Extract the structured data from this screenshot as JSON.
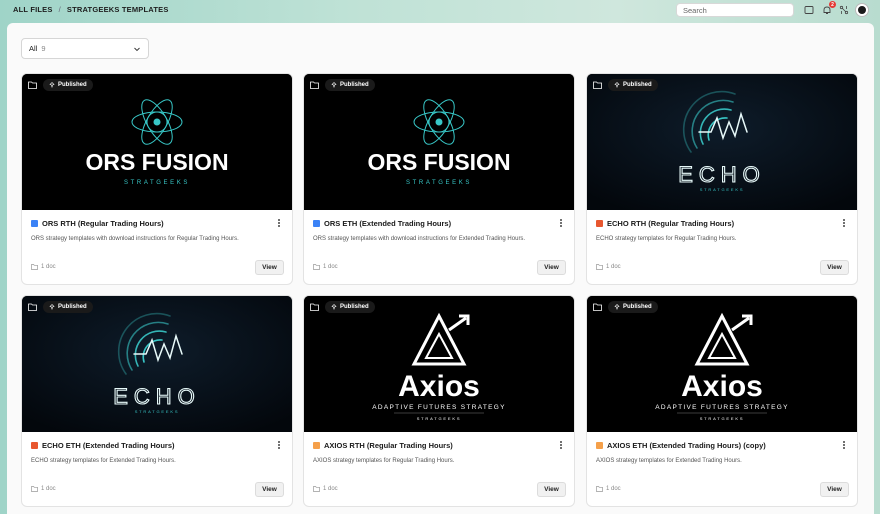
{
  "breadcrumb": {
    "root": "ALL FILES",
    "separator": "/",
    "current": "STRATGEEKS TEMPLATES"
  },
  "search": {
    "placeholder": "Search"
  },
  "toolbar": {
    "icons": [
      "chat-icon",
      "bell-icon",
      "network-icon"
    ],
    "notification_count": "2"
  },
  "filter": {
    "label": "All",
    "count": "9"
  },
  "published_label": "Published",
  "view_label": "View",
  "colors": {
    "blue": "#3b82f6",
    "red": "#e8572f",
    "orange": "#f5a04a",
    "teal": "#38c7c7"
  },
  "cards": [
    {
      "art": "ors",
      "art_title": "ORS FUSION",
      "art_sub": "STRATGEEKS",
      "square_color": "#3b82f6",
      "title": "ORS RTH (Regular Trading Hours)",
      "desc": "ORS strategy templates with download instructions for Regular Trading Hours.",
      "meta": "1 doc"
    },
    {
      "art": "ors",
      "art_title": "ORS FUSION",
      "art_sub": "STRATGEEKS",
      "square_color": "#3b82f6",
      "title": "ORS ETH (Extended Trading Hours)",
      "desc": "ORS strategy templates with download instructions for Extended Trading Hours.",
      "meta": "1 doc"
    },
    {
      "art": "echo",
      "art_title": "ECHO",
      "art_sub": "STRATGEEKS",
      "square_color": "#e8572f",
      "title": "ECHO RTH (Regular Trading Hours)",
      "desc": "ECHO strategy templates for Regular Trading Hours.",
      "meta": "1 doc"
    },
    {
      "art": "echo",
      "art_title": "ECHO",
      "art_sub": "STRATGEEKS",
      "square_color": "#e8572f",
      "title": "ECHO ETH (Extended Trading Hours)",
      "desc": "ECHO strategy templates for Extended Trading Hours.",
      "meta": "1 doc"
    },
    {
      "art": "axios",
      "art_title": "Axios",
      "art_tag": "ADAPTIVE FUTURES STRATEGY",
      "art_sub": "STRATGEEKS",
      "square_color": "#f5a04a",
      "title": "AXIOS RTH (Regular Trading Hours)",
      "desc": "AXIOS strategy templates for Regular Trading Hours.",
      "meta": "1 doc"
    },
    {
      "art": "axios",
      "art_title": "Axios",
      "art_tag": "ADAPTIVE FUTURES STRATEGY",
      "art_sub": "STRATGEEKS",
      "square_color": "#f5a04a",
      "title": "AXIOS ETH (Extended Trading Hours) (copy)",
      "desc": "AXIOS strategy templates for Extended Trading Hours.",
      "meta": "1 doc"
    }
  ]
}
